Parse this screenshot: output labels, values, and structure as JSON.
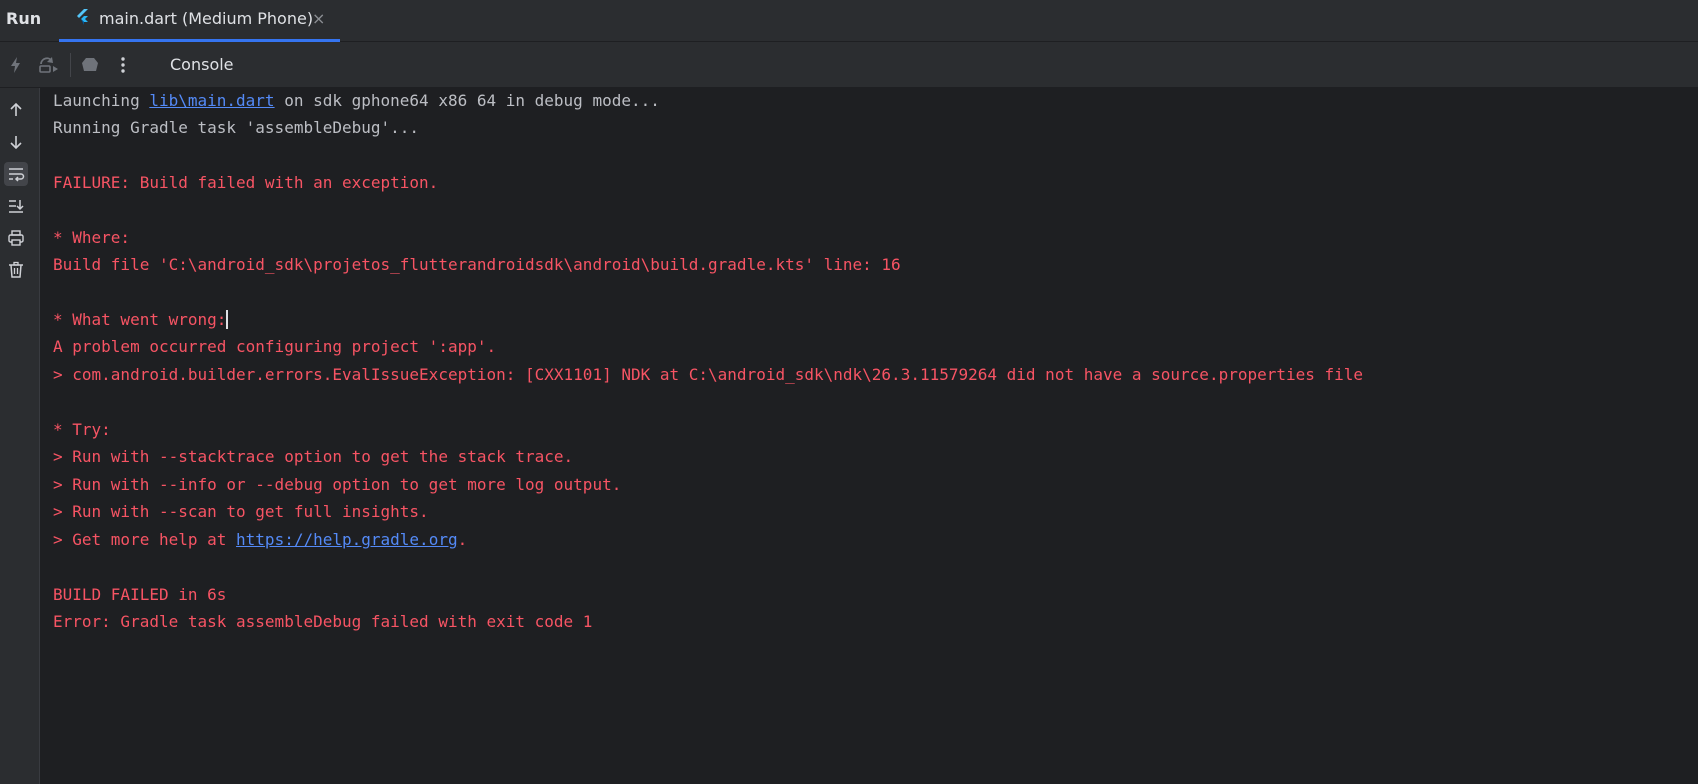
{
  "titlebar": {
    "run_label": "Run",
    "tab_label": "main.dart (Medium Phone)",
    "close_symbol": "×"
  },
  "toolbar": {
    "icons": [
      "lightning-icon",
      "restart-icon",
      "stop-icon",
      "more-icon"
    ],
    "console_label": "Console"
  },
  "gutter": {
    "icons": [
      "arrow-up-icon",
      "arrow-down-icon",
      "soft-wrap-icon",
      "scroll-to-end-icon",
      "print-icon",
      "trash-icon"
    ]
  },
  "console": {
    "line1": {
      "prefix": "Launching ",
      "link": "lib\\main.dart",
      "suffix": " on sdk gphone64 x86 64 in debug mode..."
    },
    "line2": "Running Gradle task 'assembleDebug'...",
    "line3": "FAILURE: Build failed with an exception.",
    "line4": "* Where:",
    "line5": "Build file 'C:\\android_sdk\\projetos_flutterandroidsdk\\android\\build.gradle.kts' line: 16",
    "line6": "* What went wrong:",
    "line7": "A problem occurred configuring project ':app'.",
    "line8": "> com.android.builder.errors.EvalIssueException: [CXX1101] NDK at C:\\android_sdk\\ndk\\26.3.11579264 did not have a source.properties file",
    "line9": "* Try:",
    "line10": "> Run with --stacktrace option to get the stack trace.",
    "line11": "> Run with --info or --debug option to get more log output.",
    "line12": "> Run with --scan to get full insights.",
    "line13": {
      "prefix": "> Get more help at ",
      "link": "https://help.gradle.org",
      "suffix": "."
    },
    "line14": "BUILD FAILED in 6s",
    "line15": "Error: Gradle task assembleDebug failed with exit code 1"
  },
  "colors": {
    "background": "#1e1f22",
    "panel": "#2b2d30",
    "error_text": "#f75464",
    "normal_text": "#bcbec4",
    "link": "#548af7",
    "accent": "#3574f0"
  }
}
